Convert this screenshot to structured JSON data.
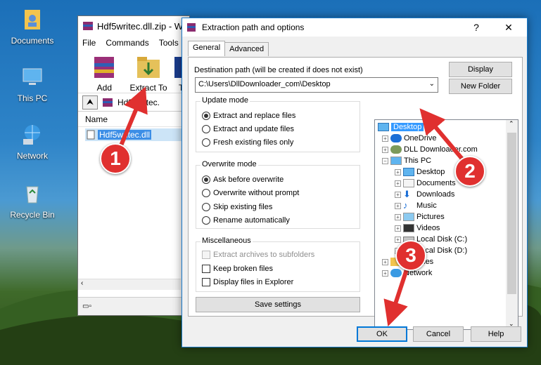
{
  "desktop": {
    "icons": [
      {
        "label": "Documents"
      },
      {
        "label": "This PC"
      },
      {
        "label": "Network"
      },
      {
        "label": "Recycle Bin"
      }
    ]
  },
  "winrar": {
    "title": "Hdf5writec.dll.zip - W",
    "menu": [
      "File",
      "Commands",
      "Tools"
    ],
    "toolbar": {
      "add": "Add",
      "extract_to": "Extract To",
      "truncated": "T"
    },
    "path": "Hdf5writec.",
    "column_name": "Name",
    "selected_file": "Hdf5writec.dll"
  },
  "dialog": {
    "title": "Extraction path and options",
    "help": "?",
    "close": "✕",
    "tabs": [
      "General",
      "Advanced"
    ],
    "destination_label": "Destination path (will be created if does not exist)",
    "destination_value": "C:\\Users\\DllDownloader_com\\Desktop",
    "display_button": "Display",
    "new_folder_button": "New Folder",
    "update_mode": {
      "title": "Update mode",
      "options": [
        "Extract and replace files",
        "Extract and update files",
        "Fresh existing files only"
      ],
      "selected": 0
    },
    "overwrite_mode": {
      "title": "Overwrite mode",
      "options": [
        "Ask before overwrite",
        "Overwrite without prompt",
        "Skip existing files",
        "Rename automatically"
      ],
      "selected": 0
    },
    "misc": {
      "title": "Miscellaneous",
      "options": [
        "Extract archives to subfolders",
        "Keep broken files",
        "Display files in Explorer"
      ]
    },
    "save_settings": "Save settings",
    "tree": [
      "Desktop",
      "OneDrive",
      "DLL Downloader.com",
      "This PC",
      "Desktop",
      "Documents",
      "Downloads",
      "Music",
      "Pictures",
      "Videos",
      "Local Disk (C:)",
      "Local Disk (D:)",
      "Libraries",
      "Network"
    ],
    "ok": "OK",
    "cancel": "Cancel",
    "help_button": "Help"
  },
  "annotations": {
    "step1": "1",
    "step2": "2",
    "step3": "3",
    "color": "#e0302f"
  }
}
